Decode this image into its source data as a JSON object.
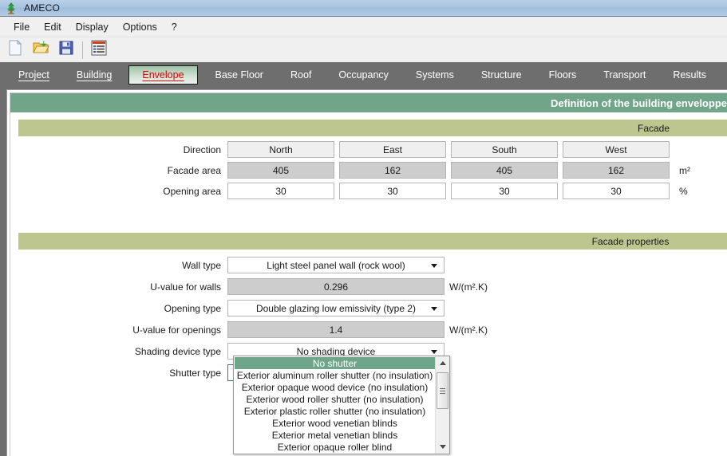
{
  "window": {
    "title": "AMECO",
    "icon": "tree-icon"
  },
  "menu": {
    "items": [
      {
        "label": "File"
      },
      {
        "label": "Edit"
      },
      {
        "label": "Display"
      },
      {
        "label": "Options"
      },
      {
        "label": "?"
      }
    ]
  },
  "toolbar": {
    "buttons": [
      {
        "icon": "new-document-icon",
        "label": "New"
      },
      {
        "icon": "open-folder-icon",
        "label": "Open"
      },
      {
        "icon": "save-floppy-icon",
        "label": "Save"
      },
      {
        "icon": "report-list-icon",
        "label": "Report"
      }
    ]
  },
  "tabs": [
    {
      "label": "Project",
      "state": "underlined"
    },
    {
      "label": "Building",
      "state": "underlined"
    },
    {
      "label": "Envelope",
      "state": "active"
    },
    {
      "label": "Base Floor",
      "state": "normal"
    },
    {
      "label": "Roof",
      "state": "normal"
    },
    {
      "label": "Occupancy",
      "state": "normal"
    },
    {
      "label": "Systems",
      "state": "normal"
    },
    {
      "label": "Structure",
      "state": "normal"
    },
    {
      "label": "Floors",
      "state": "normal"
    },
    {
      "label": "Transport",
      "state": "normal"
    },
    {
      "label": "Results",
      "state": "normal"
    }
  ],
  "panel": {
    "header": "Definition of the building enveloppe",
    "sections": {
      "facade": "Facade",
      "facade_properties": "Facade properties"
    }
  },
  "facade": {
    "rows": [
      {
        "label": "Direction",
        "kind": "readonly",
        "unit": "",
        "values": [
          "North",
          "East",
          "South",
          "West"
        ]
      },
      {
        "label": "Facade area",
        "kind": "disabled",
        "unit": "m²",
        "values": [
          "405",
          "162",
          "405",
          "162"
        ]
      },
      {
        "label": "Opening area",
        "kind": "editable",
        "unit": "%",
        "values": [
          "30",
          "30",
          "30",
          "30"
        ]
      }
    ]
  },
  "properties": {
    "wall_type": {
      "label": "Wall type",
      "value": "Light steel panel wall (rock wool)"
    },
    "u_value_walls": {
      "label": "U-value for walls",
      "value": "0.296",
      "unit": "W/(m².K)"
    },
    "opening_type": {
      "label": "Opening type",
      "value": "Double glazing low emissivity (type 2)"
    },
    "u_value_openings": {
      "label": "U-value for openings",
      "value": "1.4",
      "unit": "W/(m².K)"
    },
    "shading_device_type": {
      "label": "Shading device type",
      "value": "No shading device"
    },
    "shutter_type": {
      "label": "Shutter type",
      "value": "No shutter",
      "open": true
    }
  },
  "shutter_dropdown": {
    "selected_index": 0,
    "options": [
      "No shutter",
      "Exterior aluminum roller shutter (no insulation)",
      "Exterior opaque wood device (no insulation)",
      "Exterior wood roller shutter (no insulation)",
      "Exterior plastic roller shutter (no insulation)",
      "Exterior wood venetian blinds",
      "Exterior metal venetian blinds",
      "Exterior opaque roller blind"
    ]
  },
  "colors": {
    "header_green": "#71a58a",
    "section_khaki": "#bdc68e",
    "tab_active_text": "#e00000",
    "selection_green": "#6fa68a",
    "chrome_gray": "#6e6e6e"
  }
}
